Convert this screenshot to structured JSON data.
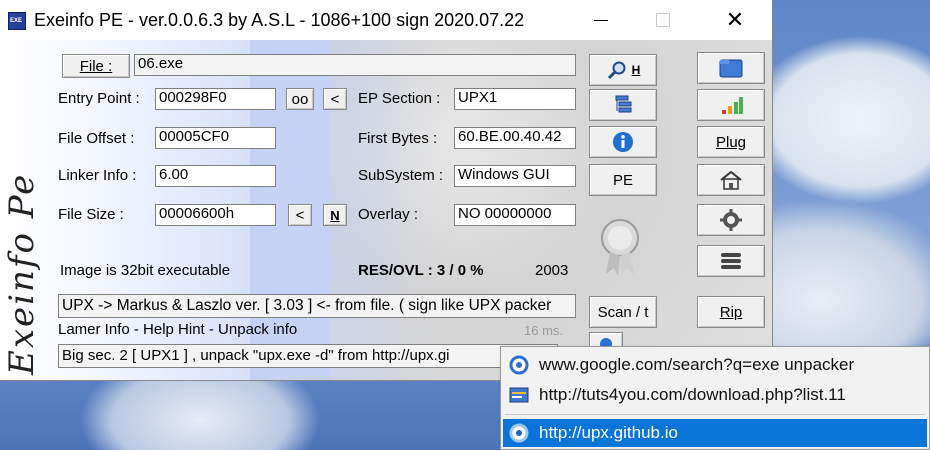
{
  "window": {
    "title": "Exeinfo PE - ver.0.0.6.3  by A.S.L -  1086+100 sign  2020.07.22",
    "brand": "Exeinfo Pe"
  },
  "fields": {
    "file_button": "File :",
    "file_value": "06.exe",
    "entry_point_label": "Entry Point :",
    "entry_point_value": "000298F0",
    "oo_button": "oo",
    "lt_button": "<",
    "ep_section_label": "EP Section :",
    "ep_section_value": "UPX1",
    "file_offset_label": "File Offset :",
    "file_offset_value": "00005CF0",
    "first_bytes_label": "First Bytes :",
    "first_bytes_value": "60.BE.00.40.42",
    "linker_info_label": "Linker Info :",
    "linker_info_value": "6.00",
    "subsystem_label": "SubSystem :",
    "subsystem_value": "Windows GUI",
    "file_size_label": "File Size :",
    "file_size_value": "00006600h",
    "lt2_button": "<",
    "n_button": "N",
    "overlay_label": "Overlay :",
    "overlay_value": "NO  00000000",
    "image_info": "Image is 32bit executable",
    "res_ovl": "RES/OVL : 3 / 0 %",
    "year": "2003",
    "detect_result": "UPX -> Markus & Laszlo ver. [ 3.03 ] <- from file. ( sign like UPX packer",
    "lamer_info": "Lamer Info - Help Hint - Unpack info",
    "time": "16 ms.",
    "hint_text": "Big sec. 2 [ UPX1 ] , unpack \"upx.exe -d\"  from  http://upx.gi"
  },
  "buttons": {
    "h_label": "H",
    "pe_label": "PE",
    "scan_label": "Scan / t",
    "plug_label": "Plug",
    "rip_label": "Rip"
  },
  "menu": {
    "items": [
      {
        "label": "www.google.com/search?q=exe unpacker",
        "icon": "google-icon"
      },
      {
        "label": "http://tuts4you.com/download.php?list.11",
        "icon": "tuts4you-icon"
      },
      {
        "label": "http://upx.github.io",
        "icon": "upx-icon"
      }
    ]
  },
  "colors": {
    "accent_blue": "#0a74d8",
    "chart_green": "#4caf50",
    "chart_orange": "#e8a020",
    "chart_red": "#d33"
  }
}
